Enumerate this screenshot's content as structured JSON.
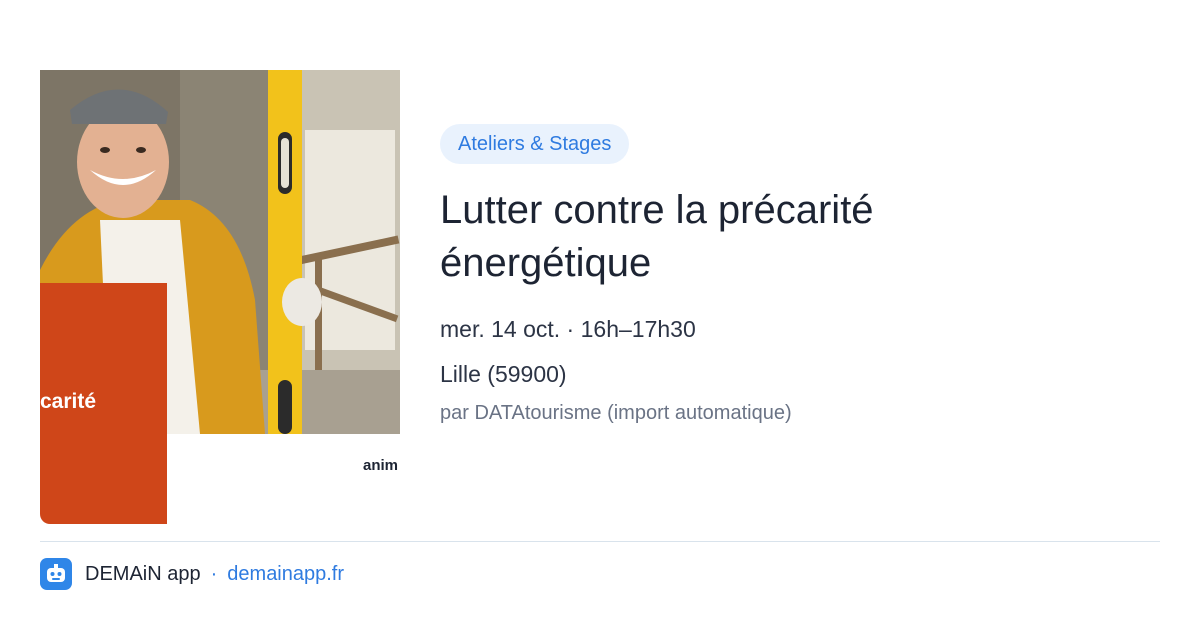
{
  "image": {
    "overlay_text": "carité",
    "corner_text": "anim",
    "accent_color": "#cf4619"
  },
  "event": {
    "category": "Ateliers & Stages",
    "title": "Lutter contre la précarité énergétique",
    "date_time": "mer. 14 oct. · 16h–17h30",
    "location": "Lille (59900)",
    "source": "par DATAtourisme (import automatique)"
  },
  "footer": {
    "app_name": "DEMAiN app",
    "separator": "·",
    "url": "demainapp.fr",
    "logo_icon": "robot-face-icon",
    "brand_color": "#2f7be0"
  }
}
